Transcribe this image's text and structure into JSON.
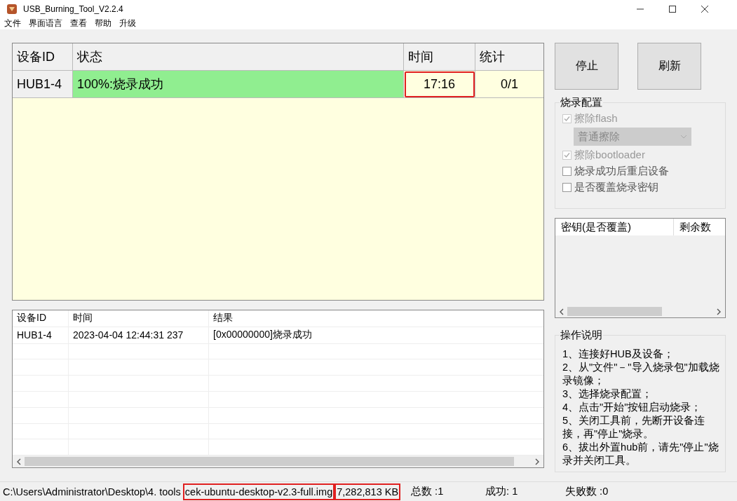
{
  "window": {
    "title": "USB_Burning_Tool_V2.2.4"
  },
  "menu": [
    "文件",
    "界面语言",
    "查看",
    "帮助",
    "升级"
  ],
  "device_table": {
    "columns": [
      "设备ID",
      "状态",
      "时间",
      "统计"
    ],
    "rows": [
      {
        "device_id": "HUB1-4",
        "status": "100%:烧录成功",
        "level": 1,
        "time": "17:16",
        "time_highlighted": true,
        "count": "0/1"
      }
    ]
  },
  "buttons": [
    "停止",
    "刷新"
  ],
  "config": {
    "title": "烧录配置",
    "items": [
      {
        "kind": "checkbox",
        "label": "擦除flash",
        "checked": true,
        "disabled": true
      },
      {
        "kind": "dropdown",
        "value": "普通擦除",
        "disabled": true
      },
      {
        "kind": "checkbox",
        "label": "擦除bootloader",
        "checked": true,
        "disabled": true
      },
      {
        "kind": "checkbox",
        "label": "烧录成功后重启设备",
        "checked": false,
        "disabled": false
      },
      {
        "kind": "checkbox",
        "label": "是否覆盖烧录密钥",
        "checked": false,
        "disabled": false
      }
    ]
  },
  "key_table": {
    "columns": [
      "密钥(是否覆盖)",
      "剩余数"
    ]
  },
  "instructions": {
    "title": "操作说明",
    "steps": [
      "1、连接好HUB及设备；",
      "2、从\"文件\"－\"导入烧录包\"加载烧录镜像；",
      "3、选择烧录配置；",
      "4、点击\"开始\"按钮启动烧录；",
      "5、关闭工具前，先断开设备连接，再\"停止\"烧录。",
      "6、拔出外置hub前，请先\"停止\"烧录并关闭工具。"
    ]
  },
  "log_table": {
    "columns": [
      "设备ID",
      "时间",
      "结果"
    ],
    "rows": [
      {
        "device_id": "HUB1-4",
        "time": "2023-04-04 12:44:31 237",
        "result": "[0x00000000]烧录成功"
      }
    ]
  },
  "status_bar": [
    {
      "text": "C:\\Users\\Administrator\\Desktop\\4. tools",
      "highlighted": false
    },
    {
      "text": "cek-ubuntu-desktop-v2.3-full.img",
      "highlighted": true
    },
    {
      "text": "7,282,813 KB",
      "highlighted": true
    },
    {
      "text": "总数 :1",
      "highlighted": false
    },
    {
      "text": "成功:  1",
      "highlighted": false
    },
    {
      "text": "失败数 :0",
      "highlighted": false
    }
  ]
}
